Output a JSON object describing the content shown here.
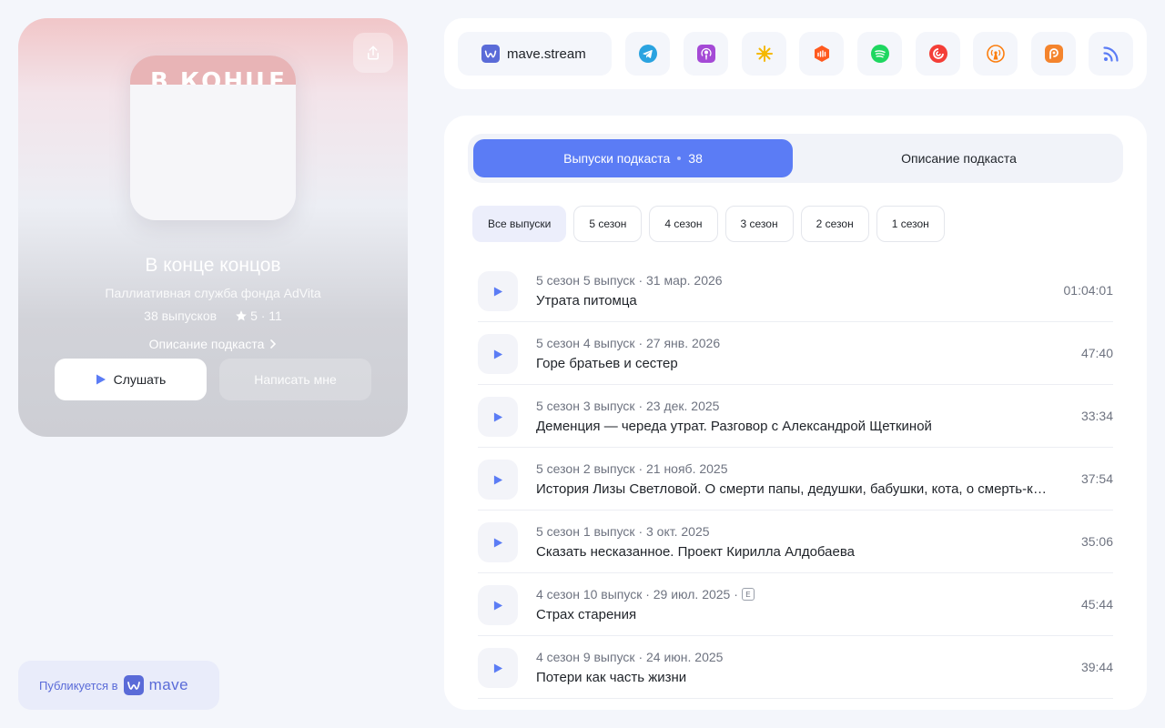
{
  "podcast": {
    "cover_word": "В КОНЦЕ",
    "title": "В конце концов",
    "author": "Паллиативная служба фонда AdVita",
    "episodes_count": "38 выпусков",
    "rating": "5 · 11",
    "description_link": "Описание подкаста",
    "listen_label": "Слушать",
    "write_label": "Написать мне"
  },
  "published": {
    "label": "Публикуется в",
    "brand": "mave"
  },
  "platforms": {
    "main_label": "mave.stream",
    "icons": [
      "telegram-icon",
      "apple-podcasts-icon",
      "yandex-music-icon",
      "soundstream-icon",
      "spotify-icon",
      "pocket-casts-icon",
      "overcast-icon",
      "podcast-addict-icon",
      "rss-icon"
    ]
  },
  "tabs": {
    "episodes_label": "Выпуски подкаста",
    "episodes_count": "38",
    "description_label": "Описание подкаста"
  },
  "seasons": [
    "Все выпуски",
    "5 сезон",
    "4 сезон",
    "3 сезон",
    "2 сезон",
    "1 сезон"
  ],
  "episodes": [
    {
      "meta": "5 сезон 5 выпуск · 31 мар. 2026",
      "title": "Утрата питомца",
      "duration": "01:04:01"
    },
    {
      "meta": "5 сезон 4 выпуск · 27 янв. 2026",
      "title": "Горе братьев и сестер",
      "duration": "47:40"
    },
    {
      "meta": "5 сезон 3 выпуск · 23 дек. 2025",
      "title": "Деменция — череда утрат. Разговор с Александрой Щеткиной",
      "duration": "33:34"
    },
    {
      "meta": "5 сезон 2 выпуск · 21 нояб. 2025",
      "title": "История Лизы Светловой. О смерти папы, дедушки, бабушки, кота, о смерть-кафе",
      "duration": "37:54"
    },
    {
      "meta": "5 сезон 1 выпуск · 3 окт. 2025",
      "title": "Сказать несказанное. Проект Кирилла Алдобаева",
      "duration": "35:06"
    },
    {
      "meta": "4 сезон 10 выпуск · 29 июл. 2025 ·",
      "explicit": "E",
      "title": "Страх старения",
      "duration": "45:44"
    },
    {
      "meta": "4 сезон 9 выпуск · 24 июн. 2025",
      "title": "Потери как часть жизни",
      "duration": "39:44"
    }
  ],
  "colors": {
    "accent": "#5b7cf5",
    "play": "#5b7cf5",
    "brand": "#5a6bd8"
  }
}
